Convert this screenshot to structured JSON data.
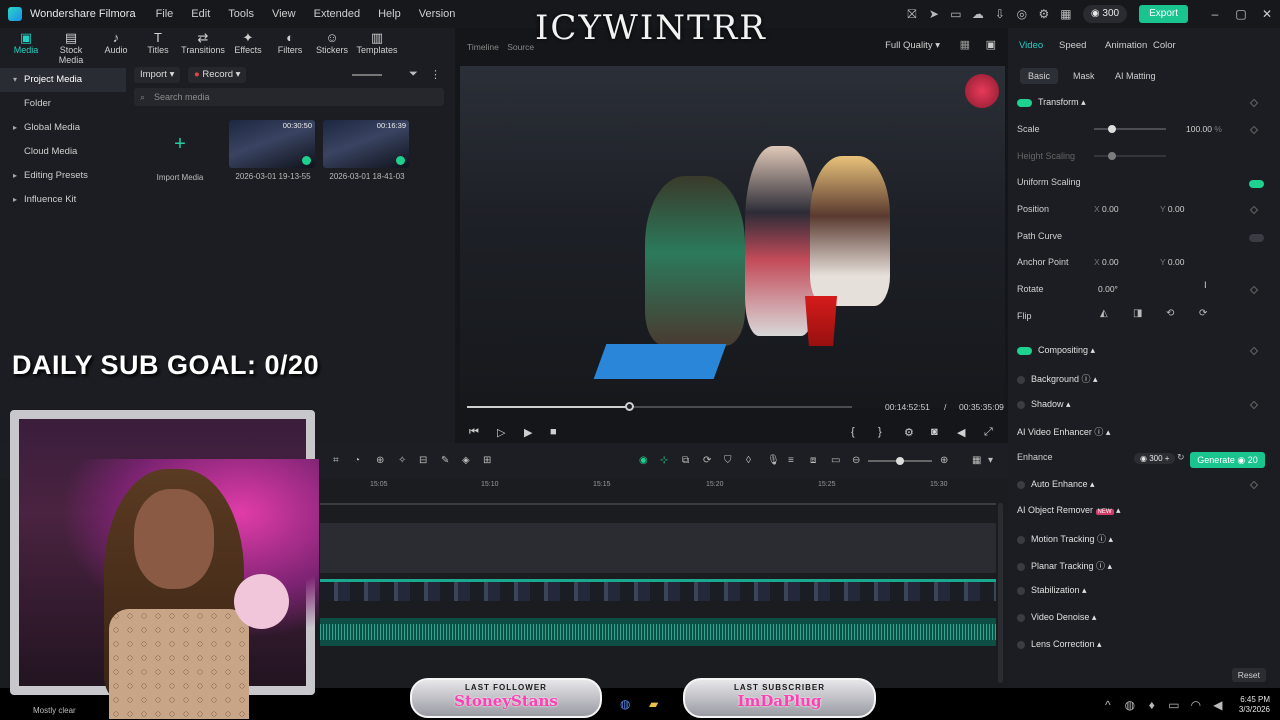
{
  "app": {
    "title": "Wondershare Filmora",
    "menus": [
      "File",
      "Edit",
      "Tools",
      "View",
      "Extended",
      "Help",
      "Version"
    ],
    "credits": "300",
    "export_label": "Export",
    "accent_color": "#19c48e"
  },
  "overlay_title": "ICYWINTRR",
  "media_tabs": [
    {
      "label": "Media",
      "icon": "media-icon"
    },
    {
      "label": "Stock Media",
      "icon": "stock-media-icon"
    },
    {
      "label": "Audio",
      "icon": "audio-icon"
    },
    {
      "label": "Titles",
      "icon": "titles-icon"
    },
    {
      "label": "Transitions",
      "icon": "transitions-icon"
    },
    {
      "label": "Effects",
      "icon": "effects-icon"
    },
    {
      "label": "Filters",
      "icon": "filters-icon"
    },
    {
      "label": "Stickers",
      "icon": "stickers-icon"
    },
    {
      "label": "Templates",
      "icon": "templates-icon"
    }
  ],
  "sidebar": {
    "items": [
      {
        "label": "Project Media"
      },
      {
        "label": "Folder"
      },
      {
        "label": "Global Media"
      },
      {
        "label": "Cloud Media"
      },
      {
        "label": "Editing Presets"
      },
      {
        "label": "Influence Kit"
      }
    ]
  },
  "media": {
    "import_label": "Import",
    "record_label": "Record",
    "search_placeholder": "Search media",
    "import_tile_label": "Import Media",
    "clips": [
      {
        "name": "2026-03-01 19-13-55",
        "duration": "00:30:50"
      },
      {
        "name": "2026-03-01 18-41-03",
        "duration": "00:16:39"
      }
    ]
  },
  "preview": {
    "tab_timeline": "Timeline",
    "tab_source": "Source",
    "quality": "Full Quality",
    "current_time": "00:14:52:51",
    "separator": "/",
    "total_time": "00:35:35:09",
    "progress": 0.42
  },
  "properties": {
    "tabs": [
      "Video",
      "Speed",
      "Animation",
      "Color"
    ],
    "sub_tabs": [
      "Basic",
      "Mask",
      "AI Matting"
    ],
    "transform": "Transform",
    "scale_label": "Scale",
    "scale_value": "100.00",
    "scale_unit": "%",
    "height_scaling": "Height Scaling",
    "uniform_scaling": "Uniform Scaling",
    "position_label": "Position",
    "position_x_label": "X",
    "position_x": "0.00",
    "position_y_label": "Y",
    "position_y": "0.00",
    "path_curve": "Path Curve",
    "anchor_label": "Anchor Point",
    "anchor_x": "0.00",
    "anchor_y": "0.00",
    "rotate_label": "Rotate",
    "rotate_value": "0.00°",
    "flip_label": "Flip",
    "compositing": "Compositing",
    "background": "Background",
    "shadow": "Shadow",
    "ai_enhancer": "AI Video Enhancer",
    "enhance": "Enhance",
    "enhance_credits": "300",
    "generate_label": "Generate",
    "generate_cost": "20",
    "auto_enhance": "Auto Enhance",
    "ai_object_remover": "AI Object Remover",
    "new_badge": "NEW",
    "motion_tracking": "Motion Tracking",
    "planar_tracking": "Planar Tracking",
    "stabilization": "Stabilization",
    "video_denoise": "Video Denoise",
    "lens_correction": "Lens Correction",
    "reset_label": "Reset"
  },
  "timeline": {
    "ruler_ticks": [
      "15:05",
      "15:10",
      "15:15",
      "15:20",
      "15:25",
      "15:30"
    ]
  },
  "stream_overlay": {
    "sub_goal": "DAILY SUB GOAL: 0/20",
    "last_follower_title": "LAST FOLLOWER",
    "last_follower_name": "StoneyStans",
    "last_subscriber_title": "LAST SUBSCRIBER",
    "last_subscriber_name": "ImDaPlug"
  },
  "taskbar": {
    "weather": "Mostly clear",
    "time": "6:45 PM",
    "date": "3/3/2026"
  }
}
